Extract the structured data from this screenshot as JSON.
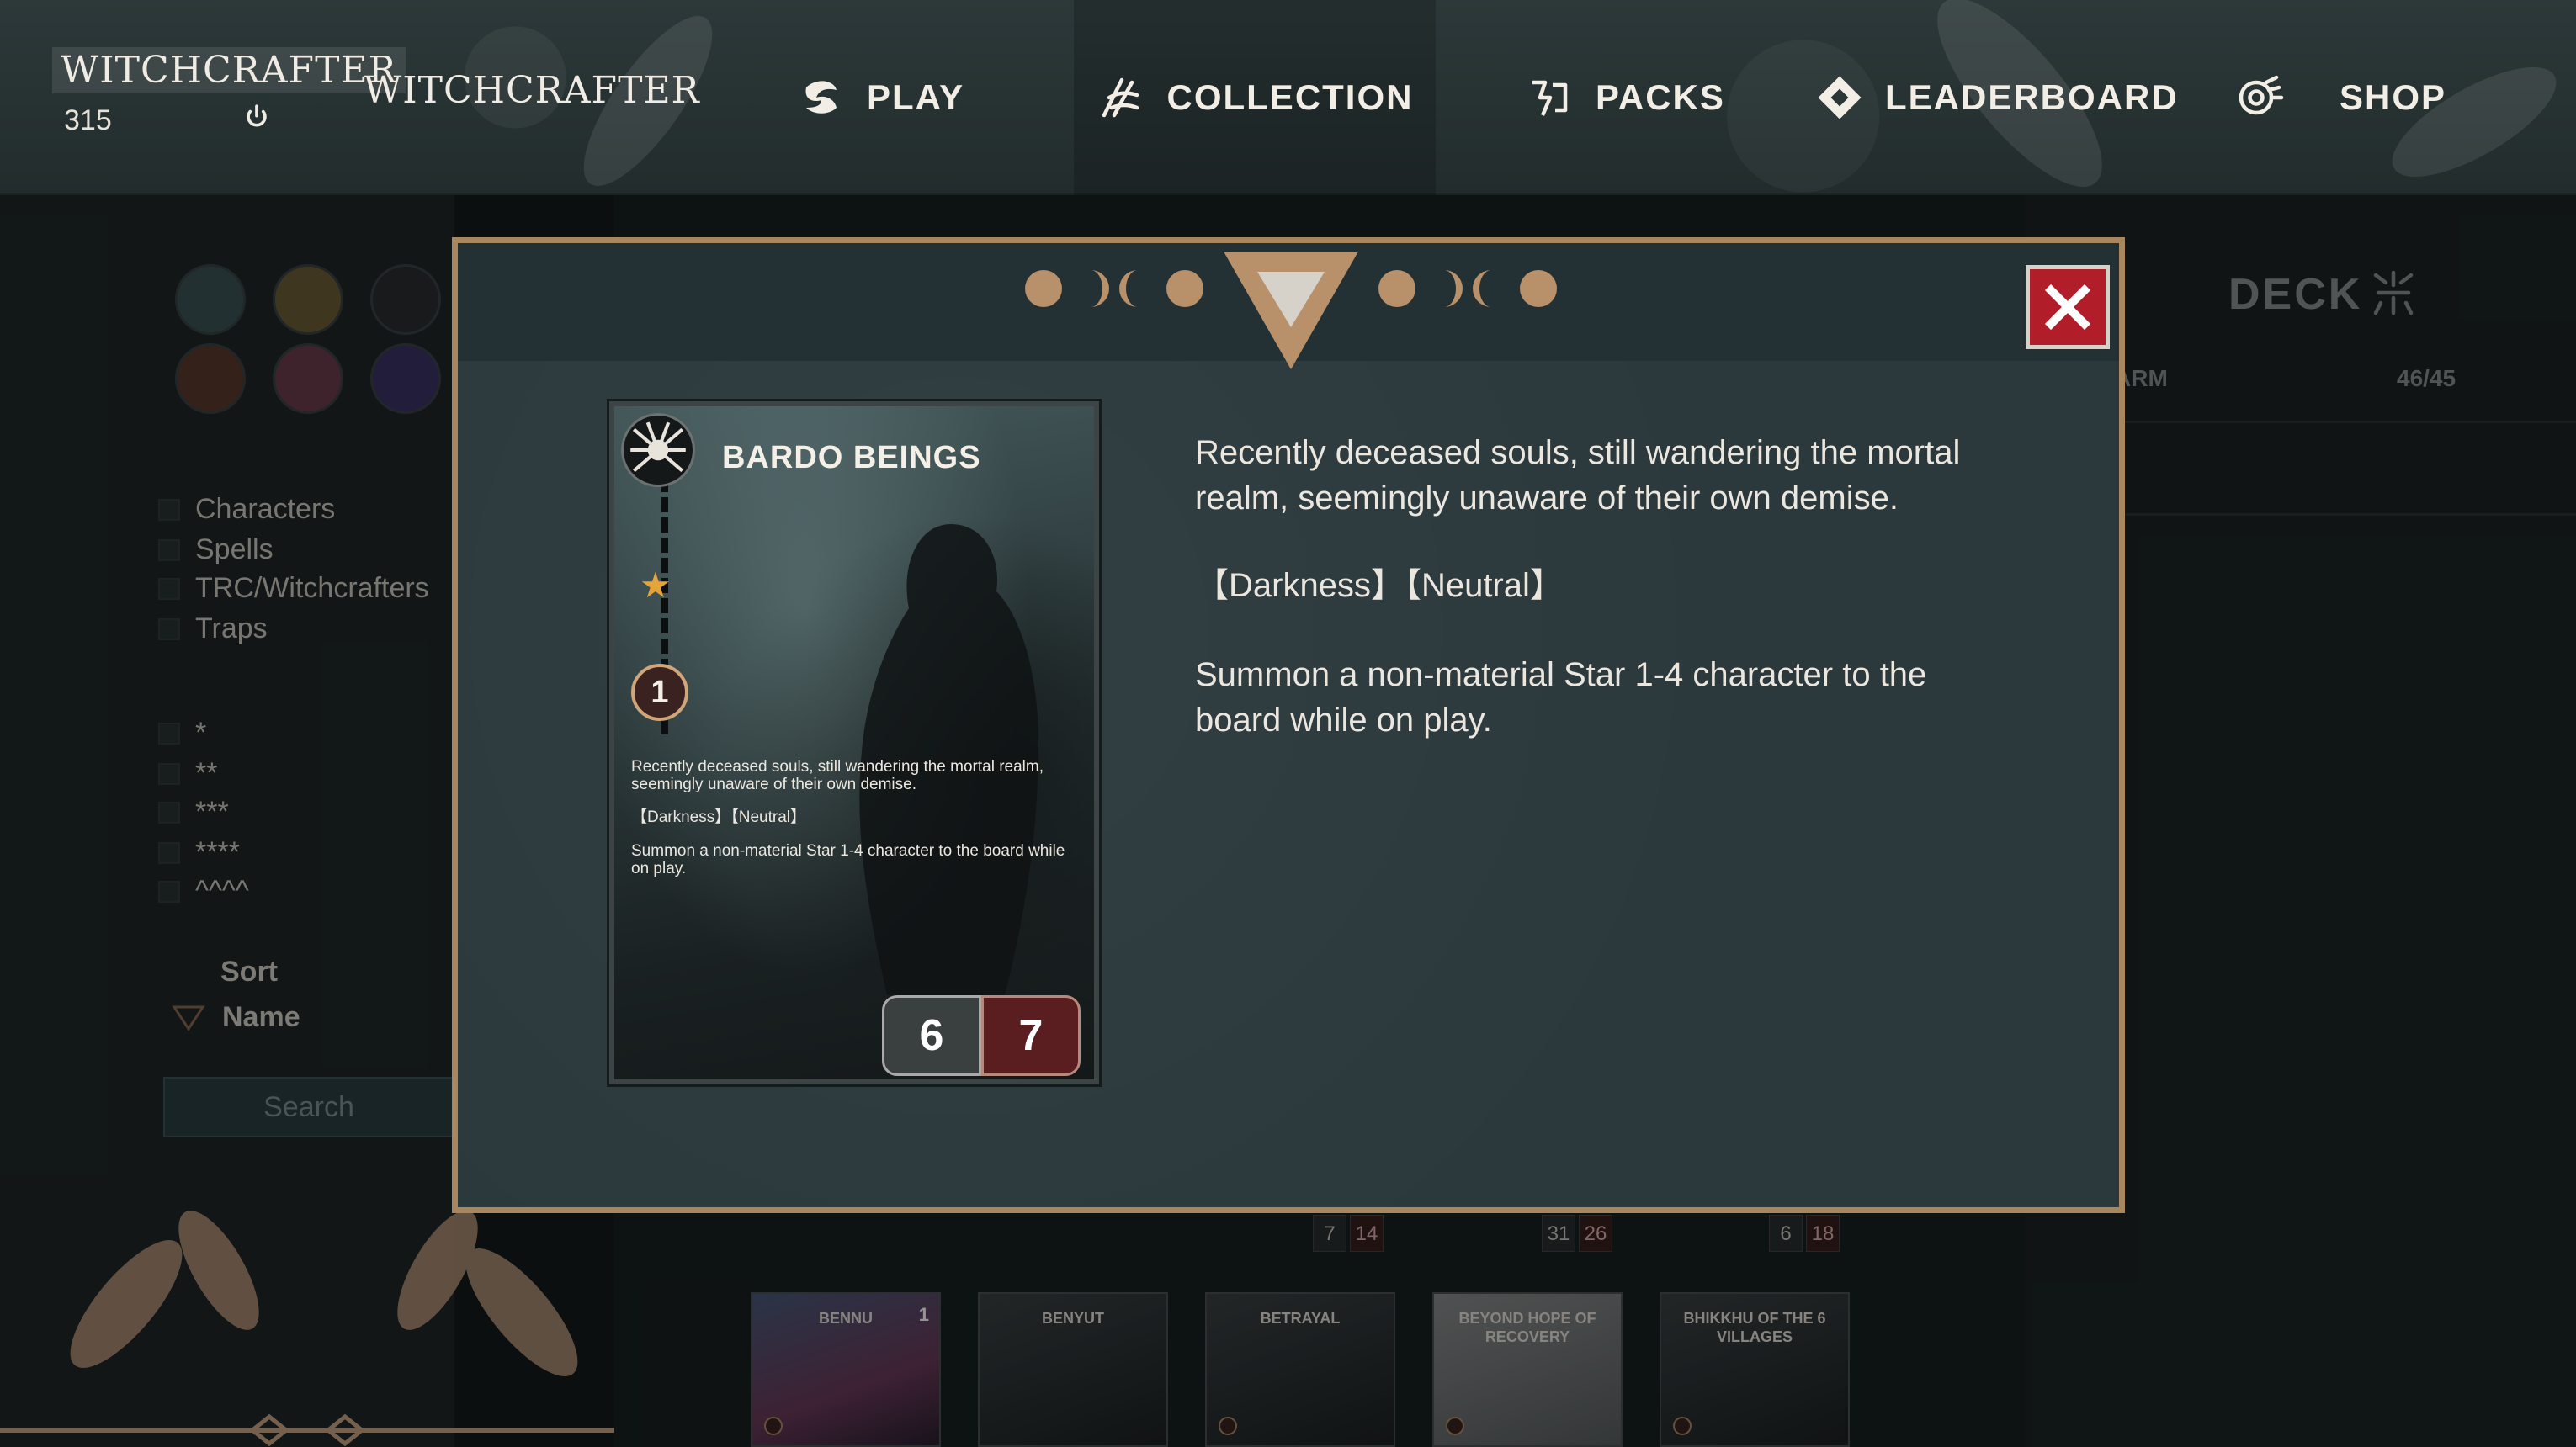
{
  "header": {
    "brand_title": "WITCHCRAFTER",
    "points": "315",
    "username": "WITCHCRAFTER",
    "nav": [
      {
        "label": "PLAY",
        "icon": "play-icon"
      },
      {
        "label": "COLLECTION",
        "icon": "collection-icon"
      },
      {
        "label": "PACKS",
        "icon": "packs-icon"
      },
      {
        "label": "LEADERBOARD",
        "icon": "leaderboard-icon"
      },
      {
        "label": "SHOP",
        "icon": "shop-icon"
      }
    ],
    "active_tab": "COLLECTION"
  },
  "sidebar": {
    "factions": [
      "brain-faction-icon",
      "winged-faction-icon",
      "spider-faction-icon",
      "claw-faction-icon",
      "chip-faction-icon",
      "eye-faction-icon"
    ],
    "types": [
      "Characters",
      "Spells",
      "TRC/Witchcrafters",
      "Traps"
    ],
    "stars": [
      "*",
      "**",
      "***",
      "****",
      "^^^^"
    ],
    "sort_title": "Sort",
    "sort_value": "Name",
    "search_placeholder": "Search"
  },
  "deck": {
    "title": "DECK",
    "subtitle": "ARM",
    "count": "46/45"
  },
  "collection": {
    "stat_pairs": [
      {
        "a": "7",
        "b": "14"
      },
      {
        "a": "31",
        "b": "26"
      },
      {
        "a": "6",
        "b": "18"
      }
    ],
    "cards": [
      {
        "name": "BENNU",
        "num": "1"
      },
      {
        "name": "BENYUT",
        "num": ""
      },
      {
        "name": "BETRAYAL",
        "num": ""
      },
      {
        "name": "BEYOND HOPE OF RECOVERY",
        "num": ""
      },
      {
        "name": "BHIKKHU OF THE 6 VILLAGES",
        "num": ""
      }
    ]
  },
  "modal": {
    "card": {
      "name": "BARDO BEINGS",
      "stars": "★",
      "cost": "1",
      "flavor": "Recently deceased souls, still wandering the mortal realm, seemingly unaware of their own demise.",
      "tags": "【Darkness】【Neutral】",
      "effect": "Summon a non-material Star 1-4 character to the board while on play.",
      "attack": "6",
      "defense": "7"
    },
    "description": {
      "flavor": "Recently deceased souls, still wandering the mortal realm, seemingly unaware of their own demise.",
      "tags": "【Darkness】【Neutral】",
      "effect": "Summon a non-material Star 1-4 character to the board while on play."
    }
  }
}
